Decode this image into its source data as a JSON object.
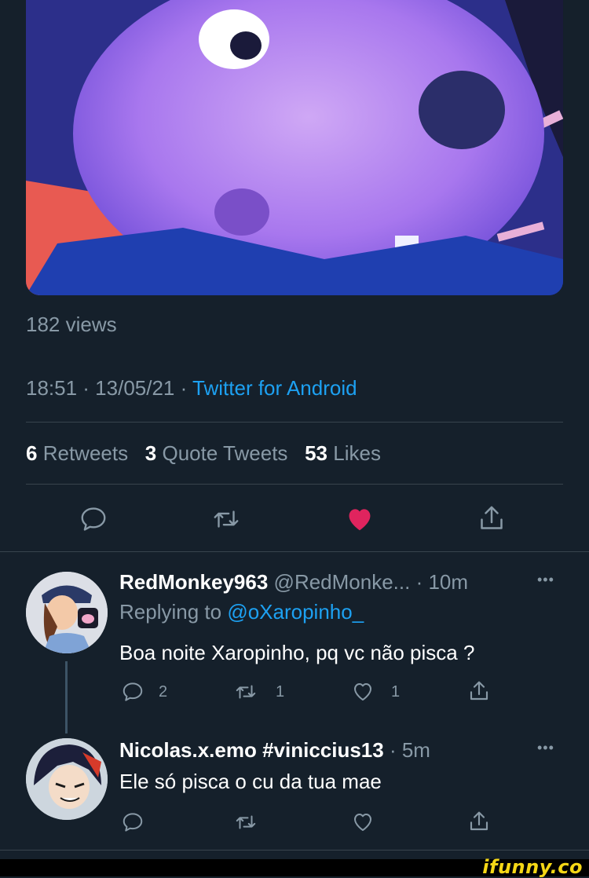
{
  "tweet": {
    "views": "182 views",
    "time": "18:51 · 13/05/21 ·",
    "source": "Twitter for Android",
    "retweets": {
      "count": "6",
      "label": "Retweets"
    },
    "quotes": {
      "count": "3",
      "label": "Quote Tweets"
    },
    "likes": {
      "count": "53",
      "label": "Likes"
    },
    "liked": true,
    "like_color": "#e0245e"
  },
  "replies": [
    {
      "display_name": "RedMonkey963",
      "handle": "@RedMonke...",
      "time": "· 10m",
      "replying_prefix": "Replying to",
      "replying_to": "@oXaropinho_",
      "text": "Boa noite Xaropinho, pq vc não pisca ?",
      "reply_count": "2",
      "retweet_count": "1",
      "like_count": "1"
    },
    {
      "display_name": "Nicolas.x.emo #viniccius13",
      "time": "· 5m",
      "text": "Ele só pisca o cu da tua mae"
    }
  ],
  "more_icon": "•••",
  "watermark": "ifunny.co",
  "colors": {
    "background": "#15202b",
    "accent": "#1da1f2",
    "muted": "#8899a6",
    "divider": "#38444d"
  }
}
